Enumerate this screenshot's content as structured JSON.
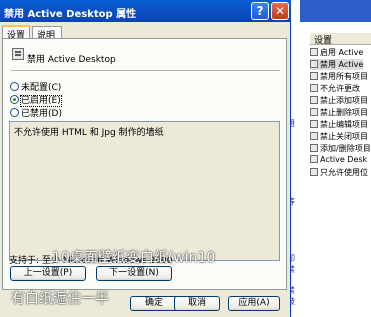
{
  "dialog": {
    "title": "禁用 Active Desktop 属性",
    "help_glyph": "?",
    "close_glyph": "✕",
    "tabs": [
      {
        "label": "设置",
        "active": true
      },
      {
        "label": "说明",
        "active": false
      }
    ],
    "policy_name": "禁用 Active Desktop",
    "radios": [
      {
        "label": "未配置(C)",
        "selected": false
      },
      {
        "label": "已启用(E)",
        "selected": true
      },
      {
        "label": "已禁用(D)",
        "selected": false
      }
    ],
    "description": "不允许使用 HTML 和 Jpg 制作的墙纸",
    "supported_on": "支持于: 至少 Microsoft Windows 2000",
    "buttons": {
      "prev": "上一设置(P)",
      "next": "下一设置(N)",
      "ok": "确定",
      "cancel": "取消",
      "apply": "应用(A)"
    },
    "icons": {
      "policy": "policy-icon",
      "help": "help-icon",
      "close": "close-icon"
    },
    "colors": {
      "title_bar": "#0b4fbf",
      "dialog_bg": "#ece9d8",
      "close_button": "#c23a1c"
    }
  },
  "overlay_caption": {
    "line1": "10桌面壁纸变白纸(win10",
    "line2": "有白纸遮住一半"
  },
  "background_window": {
    "header": "设置",
    "items": [
      "启用 Active",
      "禁用 Active",
      "禁用所有项目",
      "不允许更改",
      "禁止添加项目",
      "禁止删除项目",
      "禁止编辑项目",
      "禁止关闭项目",
      "添加/删除项目",
      "Active Desk",
      "只允许使用位"
    ],
    "side_fragments": [
      "用",
      "等",
      "卸",
      "禁",
      "禁",
      "被"
    ]
  }
}
